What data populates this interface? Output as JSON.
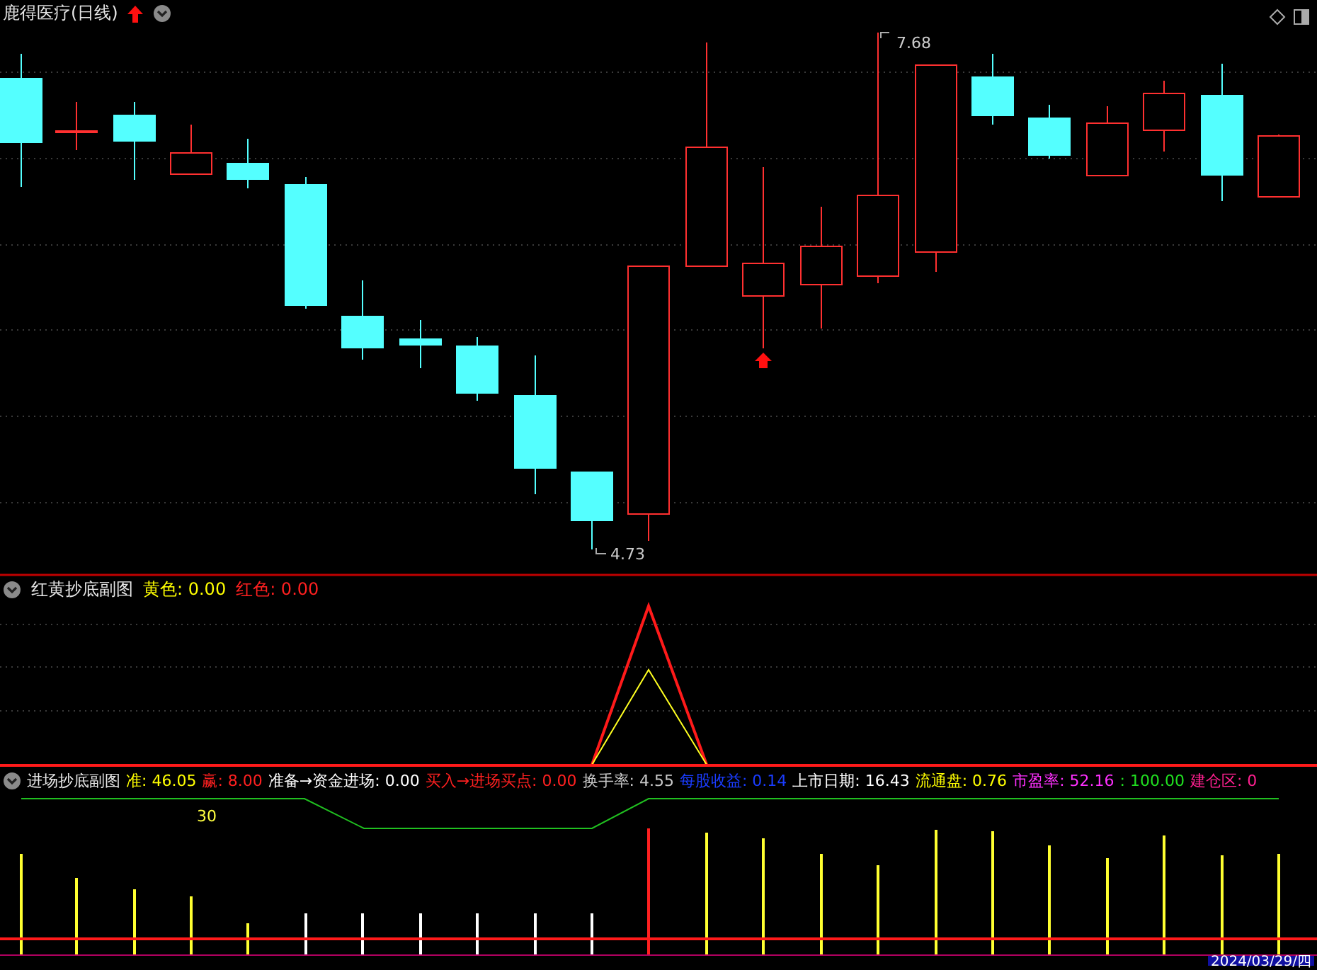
{
  "main_panel": {
    "title": "鹿得医疗(日线)",
    "high_label": "7.68",
    "low_label": "4.73"
  },
  "indicator_1": {
    "title": "红黄抄底副图",
    "readouts": [
      {
        "text": "黄色: 0.00",
        "color": "#ffff00"
      },
      {
        "text": "红色: 0.00",
        "color": "#ff2020"
      }
    ]
  },
  "indicator_2": {
    "title": "进场抄底副图",
    "level_label": "30",
    "readouts": [
      {
        "text": "准: 46.05",
        "color": "#ffff00"
      },
      {
        "text": "赢: 8.00",
        "color": "#ff2020"
      },
      {
        "text": "准备→资金进场: 0.00",
        "color": "#ffffff"
      },
      {
        "text": "买入→进场买点: 0.00",
        "color": "#ff2020"
      },
      {
        "text": "换手率: 4.55",
        "color": "#c8c8c8"
      },
      {
        "text": "每股收益: 0.14",
        "color": "#1a3cff"
      },
      {
        "text": "上市日期: 16.43",
        "color": "#ffffff"
      },
      {
        "text": "流通盘: 0.76",
        "color": "#ffff00"
      },
      {
        "text": "市盈率: 52.16",
        "color": "#ff30ff"
      },
      {
        "text": ": 100.00",
        "color": "#20e020"
      },
      {
        "text": "建仓区: 0",
        "color": "#ff2090"
      }
    ]
  },
  "time_axis": {
    "current_date": "2024/03/29/四"
  }
}
